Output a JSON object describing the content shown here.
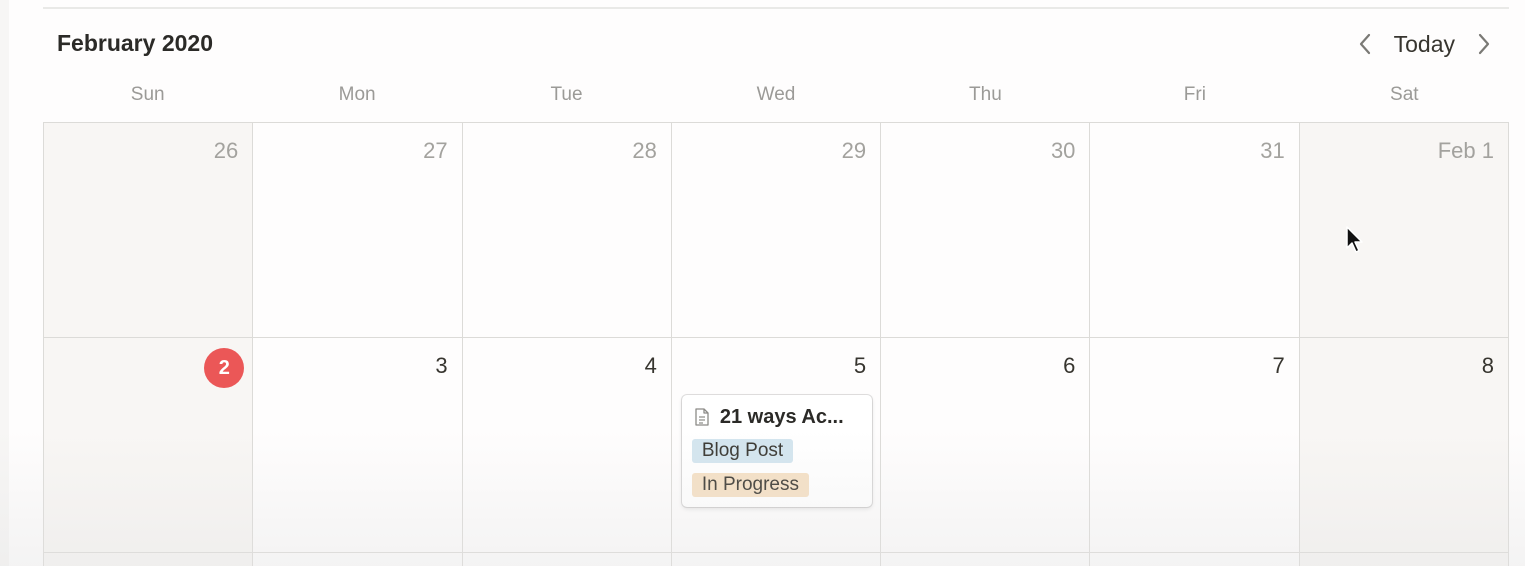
{
  "calendar": {
    "month_title": "February 2020",
    "today_label": "Today",
    "prev_icon": "chevron-left-icon",
    "next_icon": "chevron-right-icon",
    "weekdays": [
      "Sun",
      "Mon",
      "Tue",
      "Wed",
      "Thu",
      "Fri",
      "Sat"
    ],
    "weeks": [
      [
        {
          "label": "26",
          "other_month": true
        },
        {
          "label": "27",
          "other_month": true
        },
        {
          "label": "28",
          "other_month": true
        },
        {
          "label": "29",
          "other_month": true
        },
        {
          "label": "30",
          "other_month": true
        },
        {
          "label": "31",
          "other_month": true
        },
        {
          "label": "Feb 1",
          "other_month": true
        }
      ],
      [
        {
          "label": "2",
          "today": true
        },
        {
          "label": "3"
        },
        {
          "label": "4"
        },
        {
          "label": "5"
        },
        {
          "label": "6"
        },
        {
          "label": "7"
        },
        {
          "label": "8"
        }
      ]
    ],
    "event": {
      "title": "21 ways Ac...",
      "icon": "document-icon",
      "tags": [
        {
          "label": "Blog Post",
          "color": "#d3e5ef"
        },
        {
          "label": "In Progress",
          "color": "#f5e0c4"
        }
      ]
    }
  },
  "colors": {
    "today_badge": "#eb5757",
    "weekend_bg": "#f8f6f4",
    "grid_line": "#dcdbd8"
  }
}
